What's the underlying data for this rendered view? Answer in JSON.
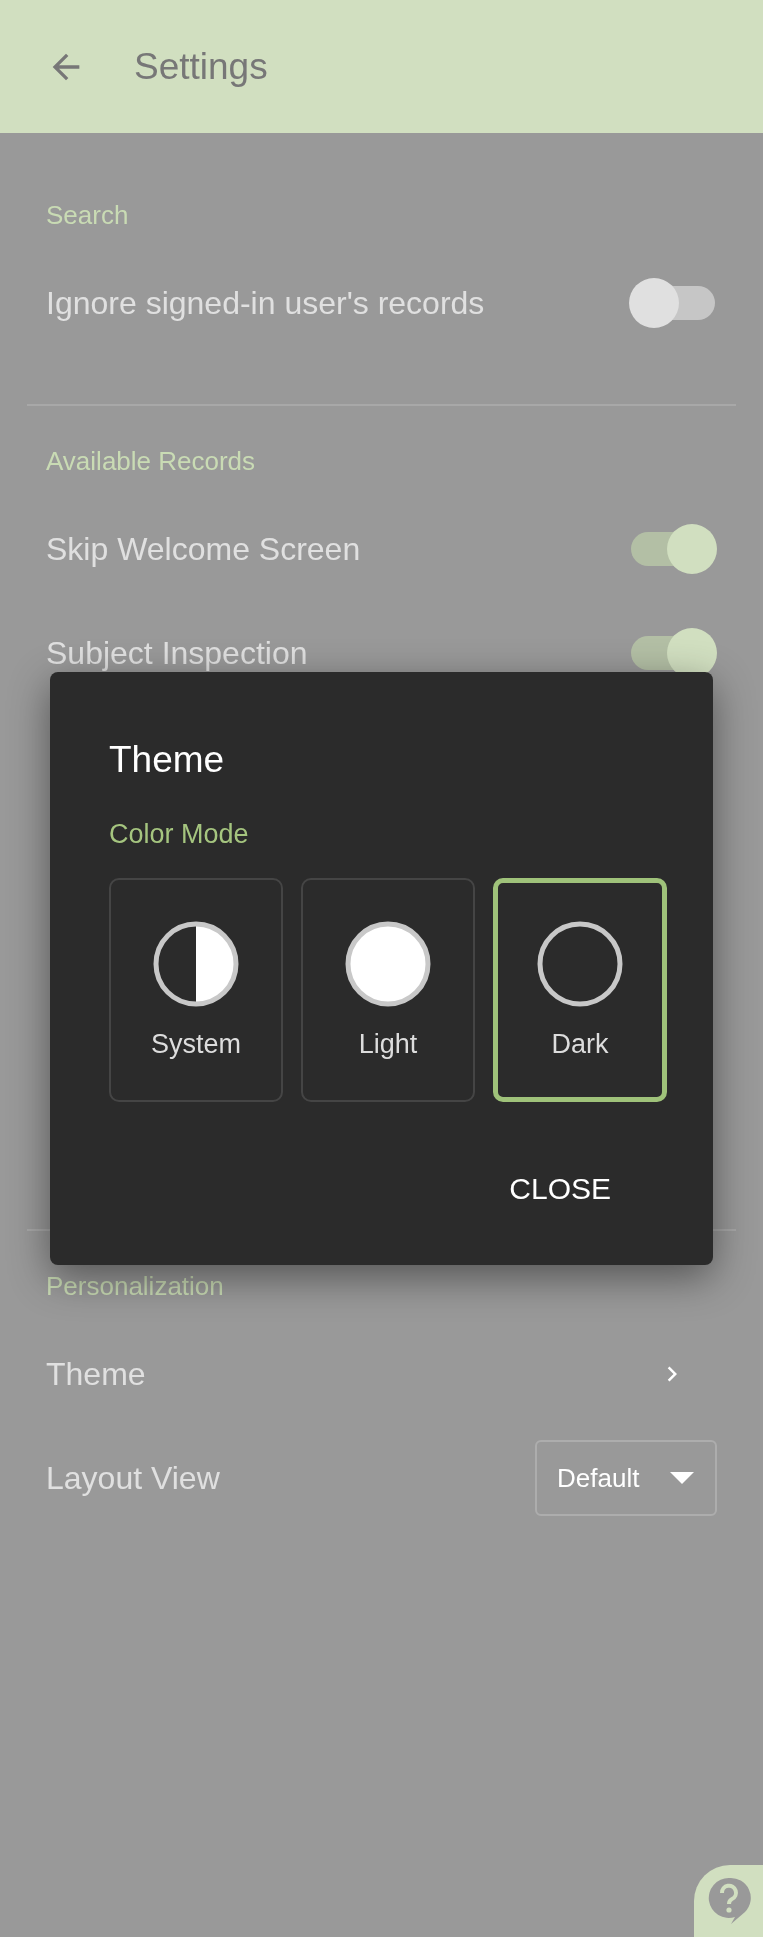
{
  "header": {
    "title": "Settings"
  },
  "sections": [
    {
      "title": "Search",
      "items": [
        {
          "kind": "toggle",
          "label": "Ignore signed-in user's records",
          "on": false
        }
      ]
    },
    {
      "title": "Available Records",
      "items": [
        {
          "kind": "toggle",
          "label": "Skip Welcome Screen",
          "on": true
        },
        {
          "kind": "toggle",
          "label": "Subject Inspection",
          "on": true
        }
      ]
    },
    {
      "title": "Personalization",
      "items": [
        {
          "kind": "link",
          "label": "Theme"
        },
        {
          "kind": "select",
          "label": "Layout View",
          "value": "Default"
        }
      ]
    }
  ],
  "dialog": {
    "title": "Theme",
    "subtitle": "Color Mode",
    "options": [
      {
        "kind": "system",
        "label": "System",
        "selected": false
      },
      {
        "kind": "light",
        "label": "Light",
        "selected": false
      },
      {
        "kind": "dark",
        "label": "Dark",
        "selected": true
      }
    ],
    "button": "CLOSE"
  }
}
